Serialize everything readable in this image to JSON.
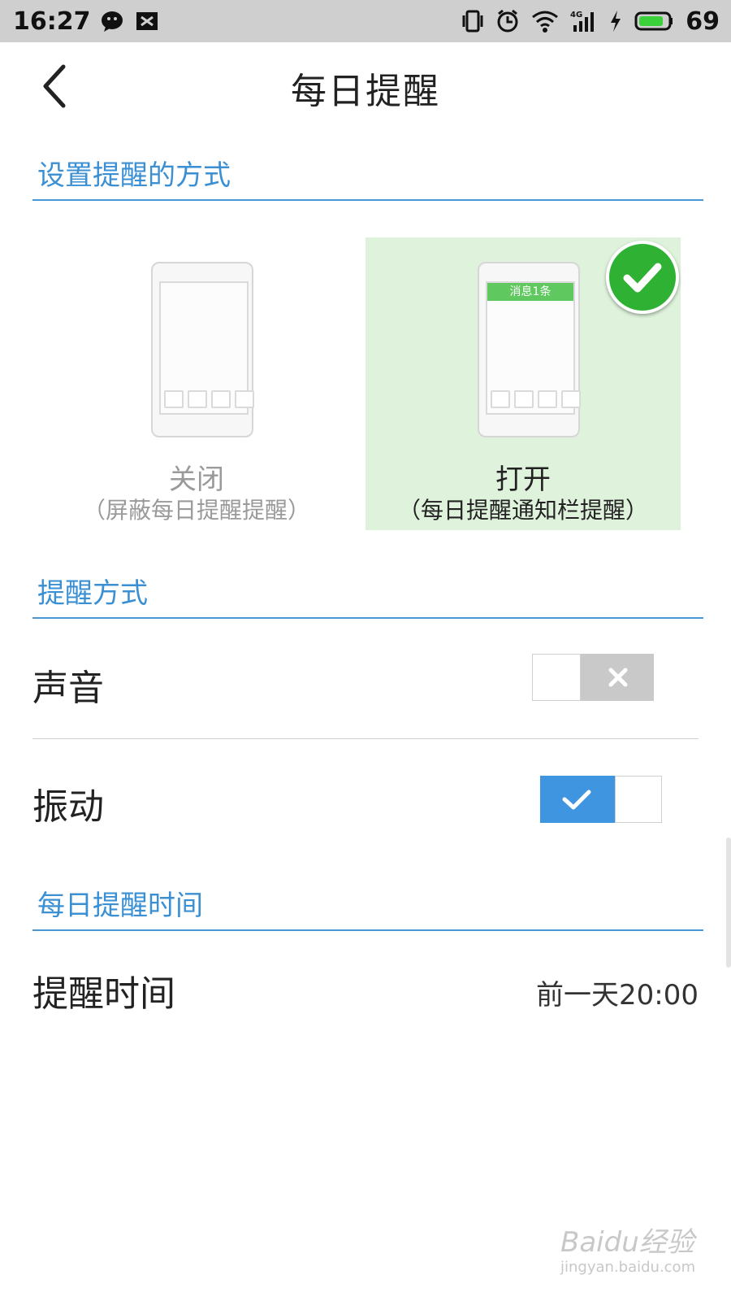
{
  "status_bar": {
    "time": "16:27",
    "battery_level": "69",
    "icons": [
      "wechat-icon",
      "image-icon",
      "vibrate-icon",
      "alarm-icon",
      "wifi-icon",
      "signal-4g-icon",
      "charging-icon",
      "battery-icon"
    ]
  },
  "header": {
    "title": "每日提醒",
    "back_icon": "chevron-left-icon"
  },
  "section_reminder_mode": {
    "title": "设置提醒的方式",
    "options": [
      {
        "label": "关闭",
        "sub": "（屏蔽每日提醒提醒）",
        "selected": false
      },
      {
        "label": "打开",
        "sub": "（每日提醒通知栏提醒）",
        "selected": true,
        "preview_notification": "消息1条"
      }
    ]
  },
  "section_alert_type": {
    "title": "提醒方式",
    "items": [
      {
        "label": "声音",
        "enabled": false
      },
      {
        "label": "振动",
        "enabled": true
      }
    ]
  },
  "section_time": {
    "title": "每日提醒时间",
    "label": "提醒时间",
    "value": "前一天20:00"
  },
  "colors": {
    "accent": "#3b8fd3",
    "toggle_on": "#3f95e0",
    "toggle_off": "#c9c9c9",
    "selected_bg": "#dff3dc",
    "check_green": "#2fb134"
  },
  "watermark": {
    "text": "Baidu经验",
    "url_text": "jingyan.baidu.com"
  }
}
